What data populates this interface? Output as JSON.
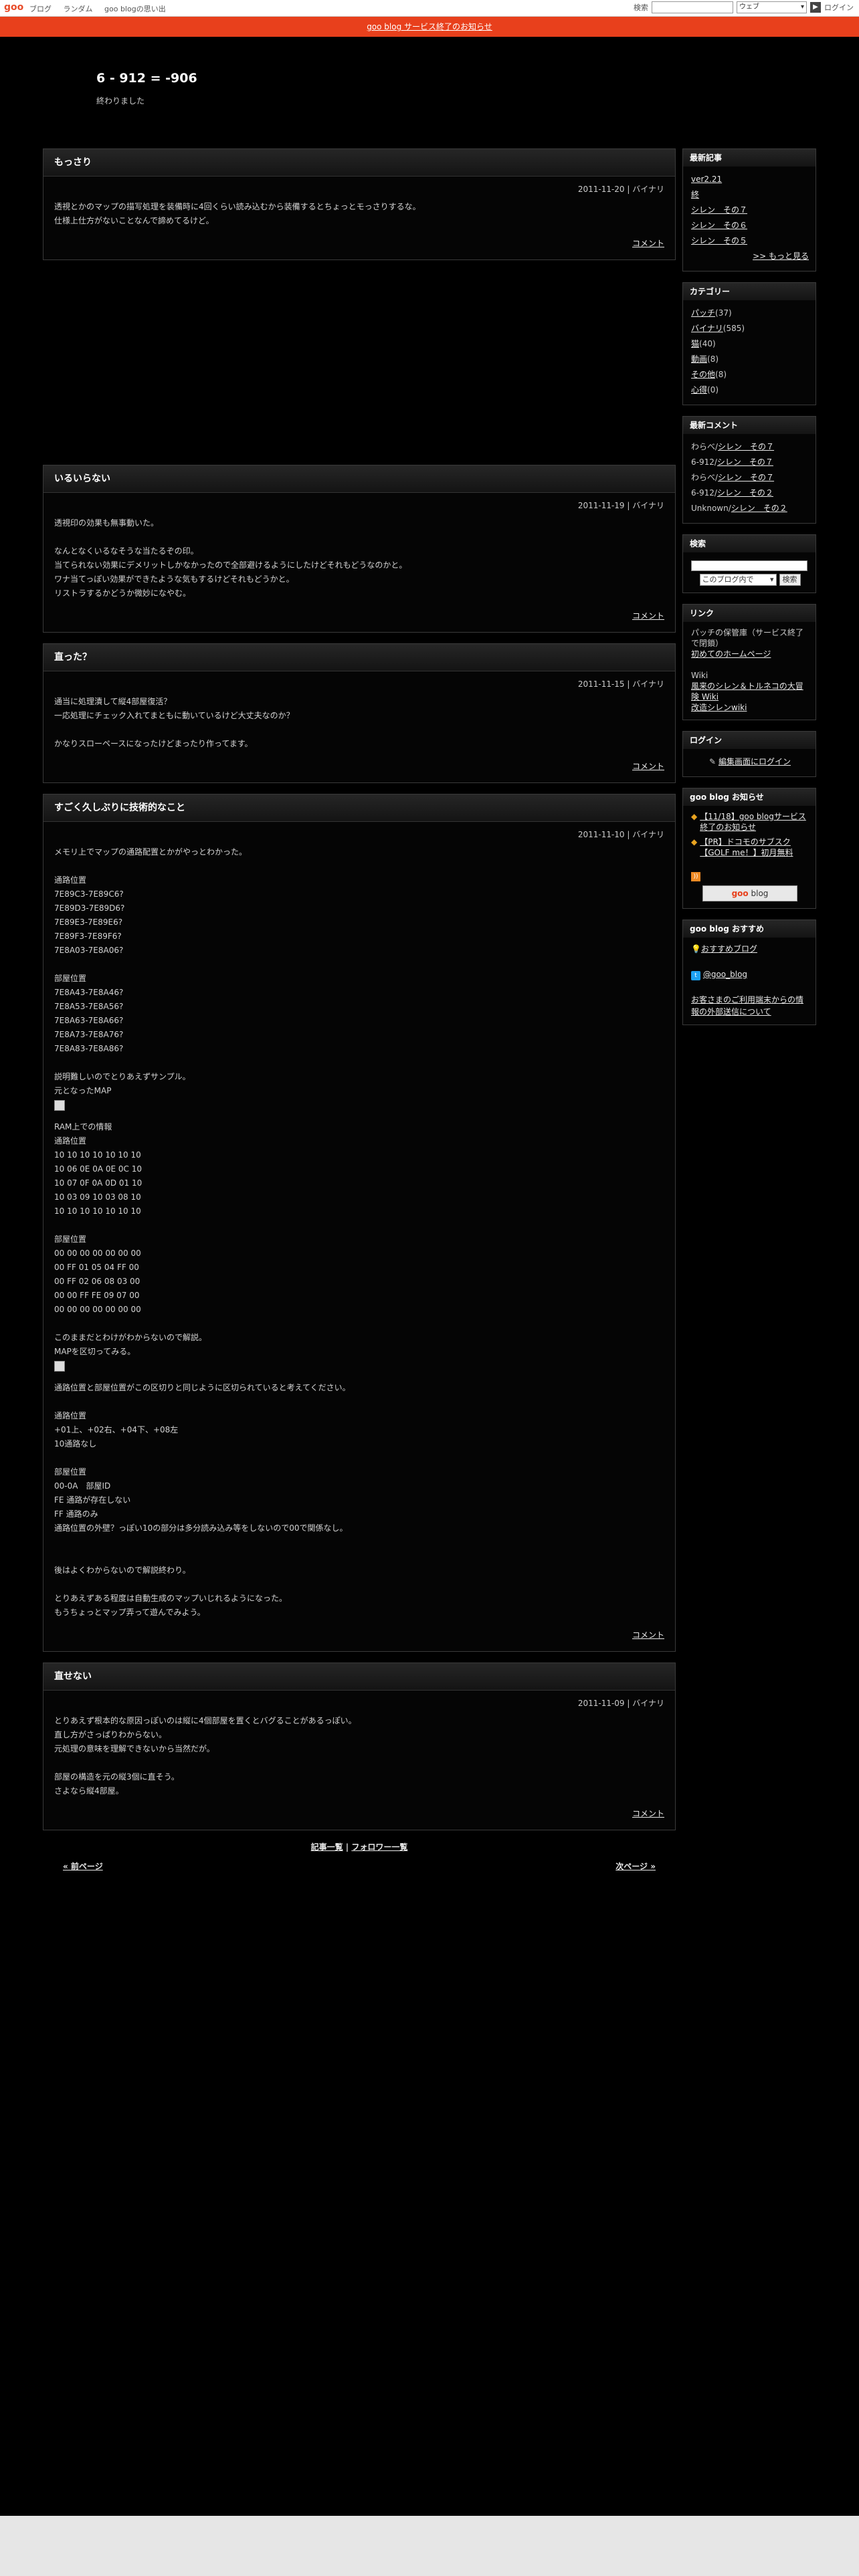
{
  "topbar": {
    "logo": "goo",
    "nav": [
      "ブログ",
      "ランダム",
      "goo blogの思い出"
    ],
    "search_label": "検索",
    "search_scope": "ウェブ",
    "login": "ログイン"
  },
  "notice": "goo blog サービス終了のお知らせ",
  "blog": {
    "title": "6 - 912 = -906",
    "description": "終わりました"
  },
  "entries": [
    {
      "title": "もっさり",
      "meta": "2011-11-20 | バイナリ",
      "body": "透視とかのマップの描写処理を装備時に4回くらい読み込むから装備するとちょっとモっさりするな。\n仕様上仕方がないことなんで諦めてるけど。",
      "comment": "コメント"
    },
    {
      "title": "いるいらない",
      "meta": "2011-11-19 | バイナリ",
      "body": "透視印の効果も無事動いた。\n\nなんとなくいるなそうな当たるぞの印。\n当てられない効果にデメリットしかなかったので全部避けるようにしたけどそれもどうなのかと。\nワナ当てっぽい効果ができたような気もするけどそれもどうかと。\nリストラするかどうか微妙になやむ。",
      "comment": "コメント"
    },
    {
      "title": "直った？",
      "meta": "2011-11-15 | バイナリ",
      "body": "通当に処理漬して縦4部屋復活？\n一応処理にチェック入れてまともに動いているけど大丈夫なのか？\n\nかなりスローペースになったけどまったり作ってます。",
      "comment": "コメント"
    },
    {
      "title": "すごく久しぶりに技術的なこと",
      "meta": "2011-11-10 | バイナリ",
      "body_a": "メモリ上でマップの通路配置とかがやっとわかった。\n\n通路位置\n7E89C3-7E89C6?\n7E89D3-7E89D6?\n7E89E3-7E89E6?\n7E89F3-7E89F6?\n7E8A03-7E8A06?\n\n部屋位置\n7E8A43-7E8A46?\n7E8A53-7E8A56?\n7E8A63-7E8A66?\n7E8A73-7E8A76?\n7E8A83-7E8A86?\n\n説明難しいのでとりあえずサンプル。\n元となったMAP",
      "body_b": "RAM上での情報\n通路位置\n10 10 10 10 10 10 10\n10 06 0E 0A 0E 0C 10\n10 07 0F 0A 0D 01 10\n10 03 09 10 03 08 10\n10 10 10 10 10 10 10\n\n部屋位置\n00 00 00 00 00 00 00\n00 FF 01 05 04 FF 00\n00 FF 02 06 08 03 00\n00 00 FF FE 09 07 00\n00 00 00 00 00 00 00\n\nこのままだとわけがわからないので解説。\nMAPを区切ってみる。",
      "body_c": "通路位置と部屋位置がこの区切りと同じように区切られていると考えてください。\n\n通路位置\n+01上、+02右、+04下、+08左\n10通路なし\n\n部屋位置\n00-0A　部屋ID\nFE 通路が存在しない\nFF 通路のみ\n通路位置の外壁？っぽい10の部分は多分読み込み等をしないので00で関係なし。\n\n\n後はよくわからないので解説終わり。\n\nとりあえずある程度は自動生成のマップいじれるようになった。\nもうちょっとマップ弄って遊んでみよう。",
      "comment": "コメント"
    },
    {
      "title": "直せない",
      "meta": "2011-11-09 | バイナリ",
      "body": "とりあえず根本的な原因っぽいのは縦に4個部屋を置くとバグることがあるっぽい。\n直し方がさっぱりわからない。\n元処理の意味を理解できないから当然だが。\n\n部屋の構造を元の縦3個に直そう。\nさよなら縦4部屋。",
      "comment": "コメント"
    }
  ],
  "list_links": {
    "articles": "記事一覧",
    "sep": " | ",
    "followers": "フォロワー一覧"
  },
  "pager": {
    "prev": "« 前ページ",
    "next": "次ページ »"
  },
  "sidebar": {
    "recent_title": "最新記事",
    "recent": [
      "ver2.21",
      "終",
      "シレン　その７",
      "シレン　その６",
      "シレン　その５"
    ],
    "recent_more": ">> もっと見る",
    "category_title": "カテゴリー",
    "categories": [
      {
        "name": "パッチ",
        "count": "(37)"
      },
      {
        "name": "バイナリ",
        "count": "(585)"
      },
      {
        "name": "猫",
        "count": "(40)"
      },
      {
        "name": "動画",
        "count": "(8)"
      },
      {
        "name": "その他",
        "count": "(8)"
      },
      {
        "name": "心得",
        "count": "(0)"
      }
    ],
    "comments_title": "最新コメント",
    "comments": [
      {
        "who": "わらべ/",
        "link": "シレン　その７"
      },
      {
        "who": "6-912/",
        "link": "シレン　その７"
      },
      {
        "who": "わらべ/",
        "link": "シレン　その７"
      },
      {
        "who": "6-912/",
        "link": "シレン　その２"
      },
      {
        "who": "Unknown/",
        "link": "シレン　その２"
      }
    ],
    "search_title": "検索",
    "search_scope": "このブログ内で",
    "search_button": "検索",
    "links_title": "リンク",
    "links_text1": "パッチの保管庫（サービス終了で閉鎖）",
    "links_a1": "初めてのホームページ",
    "links_text2": "Wiki",
    "links_a2": "風来のシレン＆トルネコの大冒険 Wiki",
    "links_a3": "改造シレンwiki",
    "login_title": "ログイン",
    "login_link": "編集画面にログイン",
    "news_title": "goo blog お知らせ",
    "news": [
      "【11/18】goo blogサービス終了のお知らせ",
      "【PR】ドコモのサブスク【GOLF me！】初月無料"
    ],
    "goo_button_a": "goo",
    "goo_button_b": " blog",
    "recommend_title": "goo blog おすすめ",
    "recommend_link": "おすすめブログ",
    "twitter": "@goo_blog",
    "footer_link": "お客さまのご利用端末からの情報の外部送信について"
  }
}
